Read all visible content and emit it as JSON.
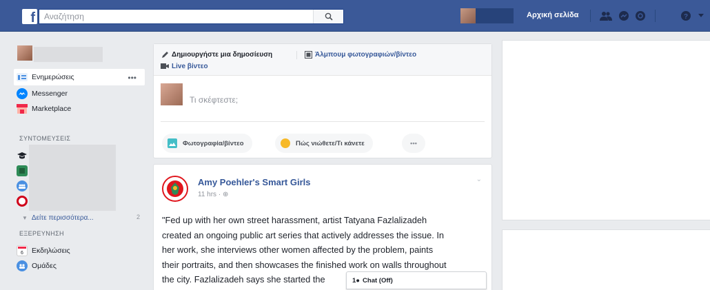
{
  "header": {
    "logo": "f",
    "search_placeholder": "Αναζήτηση",
    "home_label": "Αρχική σελίδα",
    "brand_color": "#3b5998"
  },
  "sidebar": {
    "items": [
      {
        "label": "Ενημερώσεις",
        "icon": "news-feed-icon"
      },
      {
        "label": "Messenger",
        "icon": "messenger-icon"
      },
      {
        "label": "Marketplace",
        "icon": "marketplace-icon"
      }
    ],
    "more_dots": "•••",
    "shortcuts_heading": "ΣΥΝΤΟΜΕΥΣΕΙΣ",
    "shortcut_count": "2",
    "see_more": "Δείτε περισσότερα...",
    "explore_heading": "ΕΞΕΡΕΥΝΗΣΗ",
    "explore_items": [
      {
        "label": "Εκδηλώσεις",
        "icon": "events-icon"
      },
      {
        "label": "Ομάδες",
        "icon": "groups-icon"
      }
    ]
  },
  "composer": {
    "create_post": "Δημιουργήστε μια δημοσίευση",
    "photo_album": "Άλμπουμ φωτογραφιών/βίντεο",
    "live_video": "Live βίντεο",
    "placeholder": "Τι σκέφτεστε;",
    "photo_video": "Φωτογραφία/βίντεο",
    "feeling": "Πώς νιώθετε/Τι κάνετε",
    "more": "•••"
  },
  "post": {
    "page_name": "Amy Poehler's Smart Girls",
    "meta": "11 hrs · ⊕",
    "lines": [
      "\"Fed up with her own street harassment, artist Tatyana Fazlalizadeh",
      "created an ongoing public art series that actively addresses the issue. In",
      "her work, she interviews other women affected by the problem, paints",
      "their portraits, and then showcases the finished work on walls throughout",
      "the city. Fazlalizadeh says she started the"
    ]
  },
  "chat": {
    "label": "Chat (Off)"
  }
}
